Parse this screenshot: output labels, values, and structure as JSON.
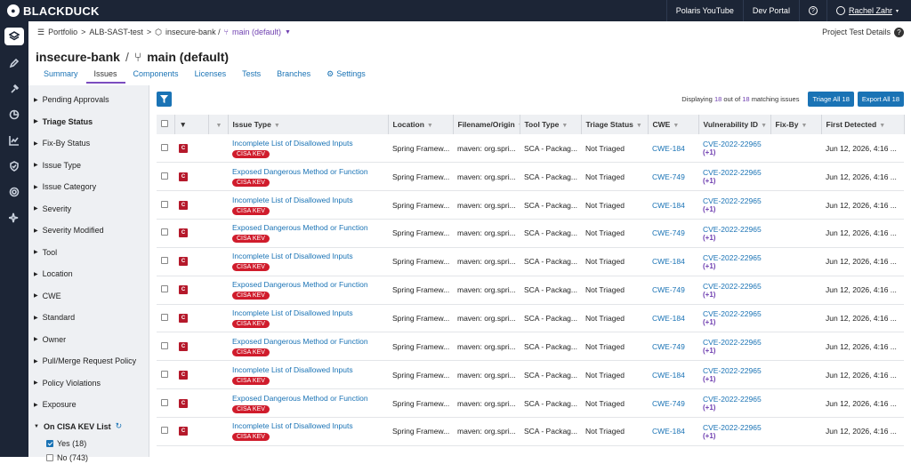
{
  "brand": "BLACKDUCK",
  "topnav": {
    "link1": "Polaris YouTube",
    "link2": "Dev Portal",
    "user": "Rachel Zahr"
  },
  "breadcrumb": {
    "portfolio": "Portfolio",
    "sep1": ">",
    "project": "ALB-SAST-test",
    "sep2": ">",
    "repo": "insecure-bank /",
    "branch": "main (default)",
    "details": "Project Test Details"
  },
  "title": {
    "repo": "insecure-bank",
    "sep": "/",
    "branch": "main (default)"
  },
  "tabs": [
    "Summary",
    "Issues",
    "Components",
    "Licenses",
    "Tests",
    "Branches",
    "Settings"
  ],
  "filters": [
    "Pending Approvals",
    "Triage Status",
    "Fix-By Status",
    "Issue Type",
    "Issue Category",
    "Severity",
    "Severity Modified",
    "Tool",
    "Location",
    "CWE",
    "Standard",
    "Owner",
    "Pull/Merge Request Policy",
    "Policy Violations",
    "Exposure",
    "On CISA KEV List"
  ],
  "kev_options": [
    {
      "label": "Yes (18)",
      "checked": true
    },
    {
      "label": "No (743)",
      "checked": false
    }
  ],
  "display": {
    "prefix": "Displaying",
    "shown": "18",
    "mid": "out of",
    "total": "18",
    "suffix": "matching issues"
  },
  "buttons": {
    "triage_all": "Triage All 18",
    "export_all": "Export All 18"
  },
  "columns": [
    "Issue Type",
    "Location",
    "Filename/Origin",
    "Tool Type",
    "Triage Status",
    "CWE",
    "Vulnerability ID",
    "Fix-By",
    "First Detected"
  ],
  "rows": [
    {
      "sev": "C",
      "type": "Incomplete List of Disallowed Inputs",
      "kev": "CISA KEV",
      "loc": "Spring Framew...",
      "file": "maven: org.spri...",
      "tool": "SCA - Packag...",
      "triage": "Not Triaged",
      "cwe": "CWE-184",
      "vuln": "CVE-2022-22965",
      "plus": "(+1)",
      "date": "Jun 12, 2026, 4:16 ..."
    },
    {
      "sev": "C",
      "type": "Exposed Dangerous Method or Function",
      "kev": "CISA KEV",
      "loc": "Spring Framew...",
      "file": "maven: org.spri...",
      "tool": "SCA - Packag...",
      "triage": "Not Triaged",
      "cwe": "CWE-749",
      "vuln": "CVE-2022-22965",
      "plus": "(+1)",
      "date": "Jun 12, 2026, 4:16 ..."
    },
    {
      "sev": "C",
      "type": "Incomplete List of Disallowed Inputs",
      "kev": "CISA KEV",
      "loc": "Spring Framew...",
      "file": "maven: org.spri...",
      "tool": "SCA - Packag...",
      "triage": "Not Triaged",
      "cwe": "CWE-184",
      "vuln": "CVE-2022-22965",
      "plus": "(+1)",
      "date": "Jun 12, 2026, 4:16 ..."
    },
    {
      "sev": "C",
      "type": "Exposed Dangerous Method or Function",
      "kev": "CISA KEV",
      "loc": "Spring Framew...",
      "file": "maven: org.spri...",
      "tool": "SCA - Packag...",
      "triage": "Not Triaged",
      "cwe": "CWE-749",
      "vuln": "CVE-2022-22965",
      "plus": "(+1)",
      "date": "Jun 12, 2026, 4:16 ..."
    },
    {
      "sev": "C",
      "type": "Incomplete List of Disallowed Inputs",
      "kev": "CISA KEV",
      "loc": "Spring Framew...",
      "file": "maven: org.spri...",
      "tool": "SCA - Packag...",
      "triage": "Not Triaged",
      "cwe": "CWE-184",
      "vuln": "CVE-2022-22965",
      "plus": "(+1)",
      "date": "Jun 12, 2026, 4:16 ..."
    },
    {
      "sev": "C",
      "type": "Exposed Dangerous Method or Function",
      "kev": "CISA KEV",
      "loc": "Spring Framew...",
      "file": "maven: org.spri...",
      "tool": "SCA - Packag...",
      "triage": "Not Triaged",
      "cwe": "CWE-749",
      "vuln": "CVE-2022-22965",
      "plus": "(+1)",
      "date": "Jun 12, 2026, 4:16 ..."
    },
    {
      "sev": "C",
      "type": "Incomplete List of Disallowed Inputs",
      "kev": "CISA KEV",
      "loc": "Spring Framew...",
      "file": "maven: org.spri...",
      "tool": "SCA - Packag...",
      "triage": "Not Triaged",
      "cwe": "CWE-184",
      "vuln": "CVE-2022-22965",
      "plus": "(+1)",
      "date": "Jun 12, 2026, 4:16 ..."
    },
    {
      "sev": "C",
      "type": "Exposed Dangerous Method or Function",
      "kev": "CISA KEV",
      "loc": "Spring Framew...",
      "file": "maven: org.spri...",
      "tool": "SCA - Packag...",
      "triage": "Not Triaged",
      "cwe": "CWE-749",
      "vuln": "CVE-2022-22965",
      "plus": "(+1)",
      "date": "Jun 12, 2026, 4:16 ..."
    },
    {
      "sev": "C",
      "type": "Incomplete List of Disallowed Inputs",
      "kev": "CISA KEV",
      "loc": "Spring Framew...",
      "file": "maven: org.spri...",
      "tool": "SCA - Packag...",
      "triage": "Not Triaged",
      "cwe": "CWE-184",
      "vuln": "CVE-2022-22965",
      "plus": "(+1)",
      "date": "Jun 12, 2026, 4:16 ..."
    },
    {
      "sev": "C",
      "type": "Exposed Dangerous Method or Function",
      "kev": "CISA KEV",
      "loc": "Spring Framew...",
      "file": "maven: org.spri...",
      "tool": "SCA - Packag...",
      "triage": "Not Triaged",
      "cwe": "CWE-749",
      "vuln": "CVE-2022-22965",
      "plus": "(+1)",
      "date": "Jun 12, 2026, 4:16 ..."
    },
    {
      "sev": "C",
      "type": "Incomplete List of Disallowed Inputs",
      "kev": "CISA KEV",
      "loc": "Spring Framew...",
      "file": "maven: org.spri...",
      "tool": "SCA - Packag...",
      "triage": "Not Triaged",
      "cwe": "CWE-184",
      "vuln": "CVE-2022-22965",
      "plus": "(+1)",
      "date": "Jun 12, 2026, 4:16 ..."
    }
  ],
  "colors": {
    "nav": "#1c2536",
    "accent": "#1a73b5",
    "critical": "#b5192b",
    "kev": "#d01c2c",
    "purple": "#6f3fb0"
  }
}
